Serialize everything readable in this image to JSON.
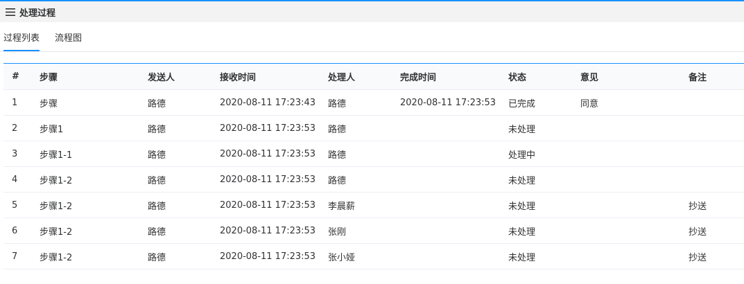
{
  "header": {
    "title": "处理过程",
    "icon": "menu-icon"
  },
  "tabs": [
    {
      "label": "过程列表",
      "active": true
    },
    {
      "label": "流程图",
      "active": false
    }
  ],
  "colors": {
    "accent": "#1890ff",
    "header_bg": "#f3f3f3"
  },
  "table": {
    "columns": [
      "#",
      "步骤",
      "发送人",
      "接收时间",
      "处理人",
      "完成时间",
      "状态",
      "意见",
      "备注"
    ],
    "rows": [
      [
        "1",
        "步骤",
        "路德",
        "2020-08-11 17:23:43",
        "路德",
        "2020-08-11 17:23:53",
        "已完成",
        "同意",
        ""
      ],
      [
        "2",
        "步骤1",
        "路德",
        "2020-08-11 17:23:53",
        "路德",
        "",
        "未处理",
        "",
        ""
      ],
      [
        "3",
        "步骤1-1",
        "路德",
        "2020-08-11 17:23:53",
        "路德",
        "",
        "处理中",
        "",
        ""
      ],
      [
        "4",
        "步骤1-2",
        "路德",
        "2020-08-11 17:23:53",
        "路德",
        "",
        "未处理",
        "",
        ""
      ],
      [
        "5",
        "步骤1-2",
        "路德",
        "2020-08-11 17:23:53",
        "李晨薪",
        "",
        "未处理",
        "",
        "抄送"
      ],
      [
        "6",
        "步骤1-2",
        "路德",
        "2020-08-11 17:23:53",
        "张刚",
        "",
        "未处理",
        "",
        "抄送"
      ],
      [
        "7",
        "步骤1-2",
        "路德",
        "2020-08-11 17:23:53",
        "张小娅",
        "",
        "未处理",
        "",
        "抄送"
      ]
    ]
  }
}
